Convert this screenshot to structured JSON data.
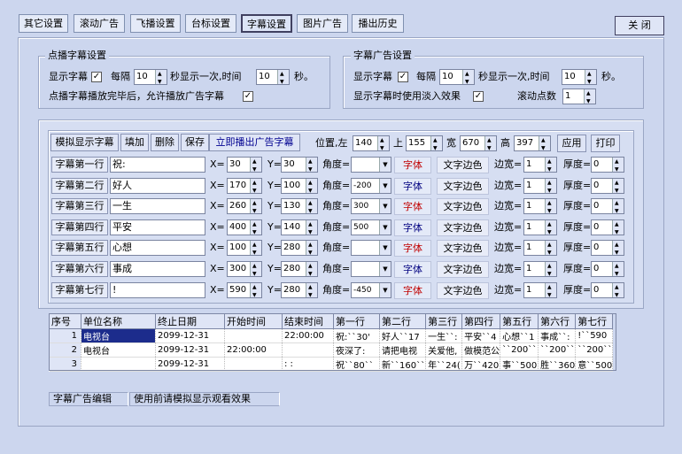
{
  "tabs": [
    {
      "label": "其它设置"
    },
    {
      "label": "滚动广告"
    },
    {
      "label": "飞播设置"
    },
    {
      "label": "台标设置"
    },
    {
      "label": "字幕设置"
    },
    {
      "label": "图片广告"
    },
    {
      "label": "播出历史"
    }
  ],
  "close_label": "关  闭",
  "ondemand": {
    "title": "点播字幕设置",
    "show_label": "显示字幕",
    "show_checked": "✓",
    "every_label": "每隔",
    "every_value": "10",
    "seconds_once": "秒显示一次,时间",
    "time_value": "10",
    "sec_unit": "秒。",
    "allow_label": "点播字幕播放完毕后，允许播放广告字幕",
    "allow_checked": "✓"
  },
  "adsub": {
    "title": "字幕广告设置",
    "show_label": "显示字幕",
    "show_checked": "✓",
    "every_label": "每隔",
    "every_value": "10",
    "seconds_once": "秒显示一次,时间",
    "time_value": "10",
    "sec_unit": "秒。",
    "fade_label": "显示字幕时使用淡入效果",
    "fade_checked": "✓",
    "scroll_label": "滚动点数",
    "scroll_value": "1"
  },
  "toolbar": {
    "simulate": "模拟显示字幕",
    "add": "填加",
    "delete": "删除",
    "save": "保存",
    "play_now": "立即播出广告字幕",
    "pos_label": "位置,左",
    "left": "140",
    "top_label": "上",
    "top": "155",
    "width_label": "宽",
    "width": "670",
    "height_label": "高",
    "height": "397",
    "apply": "应用",
    "print": "打印"
  },
  "field_labels": {
    "x": "X=",
    "y": "Y=",
    "angle": "角度=",
    "font": "字体",
    "edge_color": "文字边色",
    "edge_width": "边宽=",
    "thickness": "厚度="
  },
  "rows": [
    {
      "label": "字幕第一行",
      "text": "祝:",
      "x": "30",
      "y": "30",
      "angle": "",
      "edge": "1",
      "thick": "0",
      "font_color": "#c00000"
    },
    {
      "label": "字幕第二行",
      "text": "好人",
      "x": "170",
      "y": "100",
      "angle": "-200",
      "edge": "1",
      "thick": "0",
      "font_color": "#000080"
    },
    {
      "label": "字幕第三行",
      "text": "一生",
      "x": "260",
      "y": "130",
      "angle": "300",
      "edge": "1",
      "thick": "0",
      "font_color": "#c00000"
    },
    {
      "label": "字幕第四行",
      "text": "平安",
      "x": "400",
      "y": "140",
      "angle": "500",
      "edge": "1",
      "thick": "0",
      "font_color": "#000080"
    },
    {
      "label": "字幕第五行",
      "text": "心想",
      "x": "100",
      "y": "280",
      "angle": "",
      "edge": "1",
      "thick": "0",
      "font_color": "#c00000"
    },
    {
      "label": "字幕第六行",
      "text": "事成",
      "x": "300",
      "y": "280",
      "angle": "",
      "edge": "1",
      "thick": "0",
      "font_color": "#000080"
    },
    {
      "label": "字幕第七行",
      "text": "!",
      "x": "590",
      "y": "280",
      "angle": "-450",
      "edge": "1",
      "thick": "0",
      "font_color": "#c00000"
    }
  ],
  "table": {
    "headers": [
      "序号",
      "单位名称",
      "终止日期",
      "开始时间",
      "结束时间",
      "第一行",
      "第二行",
      "第三行",
      "第四行",
      "第五行",
      "第六行",
      "第七行"
    ],
    "rows": [
      [
        "1",
        "电视台",
        "2099-12-31",
        "",
        "22:00:00",
        "祝:``30'",
        "好人``17",
        "一生``:",
        "平安``4",
        "心想``1",
        "事成``:",
        "!``590"
      ],
      [
        "2",
        "电视台",
        "2099-12-31",
        "22:00:00",
        "",
        "夜深了:",
        "请把电视",
        "关爱他,",
        "做模范公",
        "``200``",
        "``200``",
        "``200``"
      ],
      [
        "3",
        "",
        "2099-12-31",
        "",
        ":  :",
        "祝``80``",
        "新``160``",
        "年``24(",
        "万``420",
        "事``500",
        "胜``360",
        "意``500"
      ]
    ]
  },
  "status": {
    "edit": "字幕广告编辑",
    "hint": "使用前请模拟显示观看效果"
  }
}
